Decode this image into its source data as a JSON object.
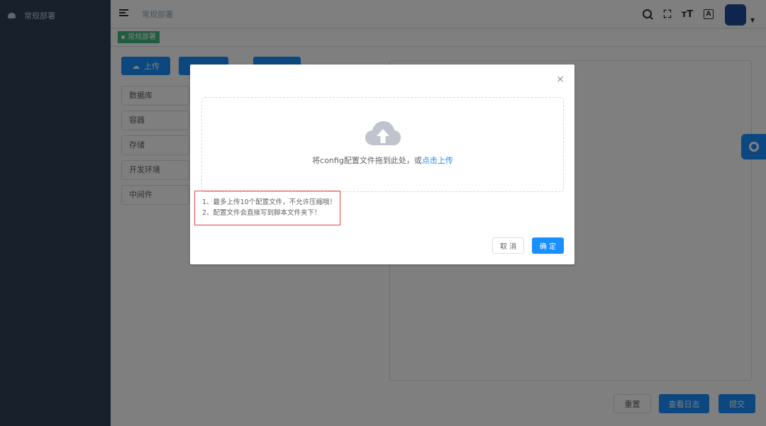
{
  "sidebar": {
    "items": [
      {
        "label": "常规部署",
        "icon": "deploy-icon"
      }
    ]
  },
  "header": {
    "breadcrumb": "常规部署",
    "icons": [
      "menu-icon",
      "search-icon",
      "fullscreen-icon",
      "font-size-icon",
      "translate-icon"
    ]
  },
  "tags": [
    {
      "label": "常规部署"
    }
  ],
  "main": {
    "toolbar": {
      "upload_label": "上传",
      "button2_label": "",
      "button3_label": ""
    },
    "list": [
      "数据库",
      "容器",
      "存储",
      "开发环境",
      "中间件"
    ],
    "actions": {
      "reset_label": "重置",
      "view_log_label": "查看日志",
      "submit_label": "提交"
    }
  },
  "dialog": {
    "drop_text_prefix": "将config配置文件拖到此处，或",
    "drop_text_link": "点击上传",
    "tips": [
      "1、最多上传10个配置文件，不允许压缩哦！",
      "2、配置文件会直接写到脚本文件夹下！"
    ],
    "cancel_label": "取 消",
    "confirm_label": "确 定",
    "close_symbol": "×"
  },
  "colors": {
    "primary": "#1890ff",
    "sidebar_bg": "#304156",
    "tag_bg": "#42b983",
    "tips_border": "#e84040"
  }
}
